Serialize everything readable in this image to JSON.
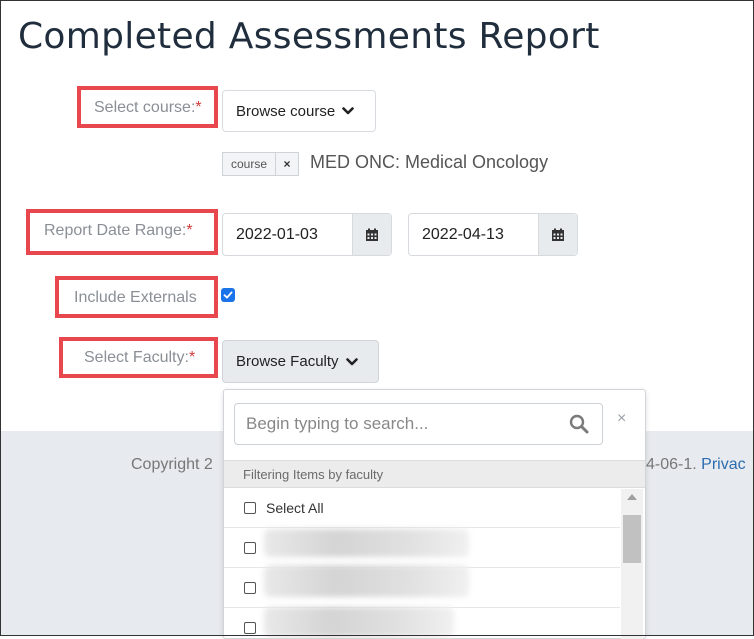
{
  "page_title": "Completed Assessments Report",
  "form": {
    "course": {
      "label": "Select course:",
      "required_mark": "*",
      "browse_label": "Browse course",
      "tag_label": "course",
      "tag_remove": "×",
      "selected_course": "MED ONC: Medical Oncology"
    },
    "date_range": {
      "label": "Report Date Range:",
      "required_mark": "*",
      "start_date": "2022-01-03",
      "end_date": "2022-04-13"
    },
    "externals": {
      "label": "Include Externals",
      "checked": true
    },
    "faculty": {
      "label": "Select Faculty:",
      "required_mark": "*",
      "browse_label": "Browse Faculty"
    }
  },
  "faculty_dropdown": {
    "search_placeholder": "Begin typing to search...",
    "close_label": "×",
    "group_header": "Filtering Items by faculty",
    "select_all_label": "Select All"
  },
  "footer": {
    "left_text": "Copyright 2",
    "right_text": "4-06-1.",
    "right_link": "Privac"
  },
  "colors": {
    "highlight": "#e8484d",
    "required": "#d13a3a",
    "checkbox": "#1a73e8"
  }
}
